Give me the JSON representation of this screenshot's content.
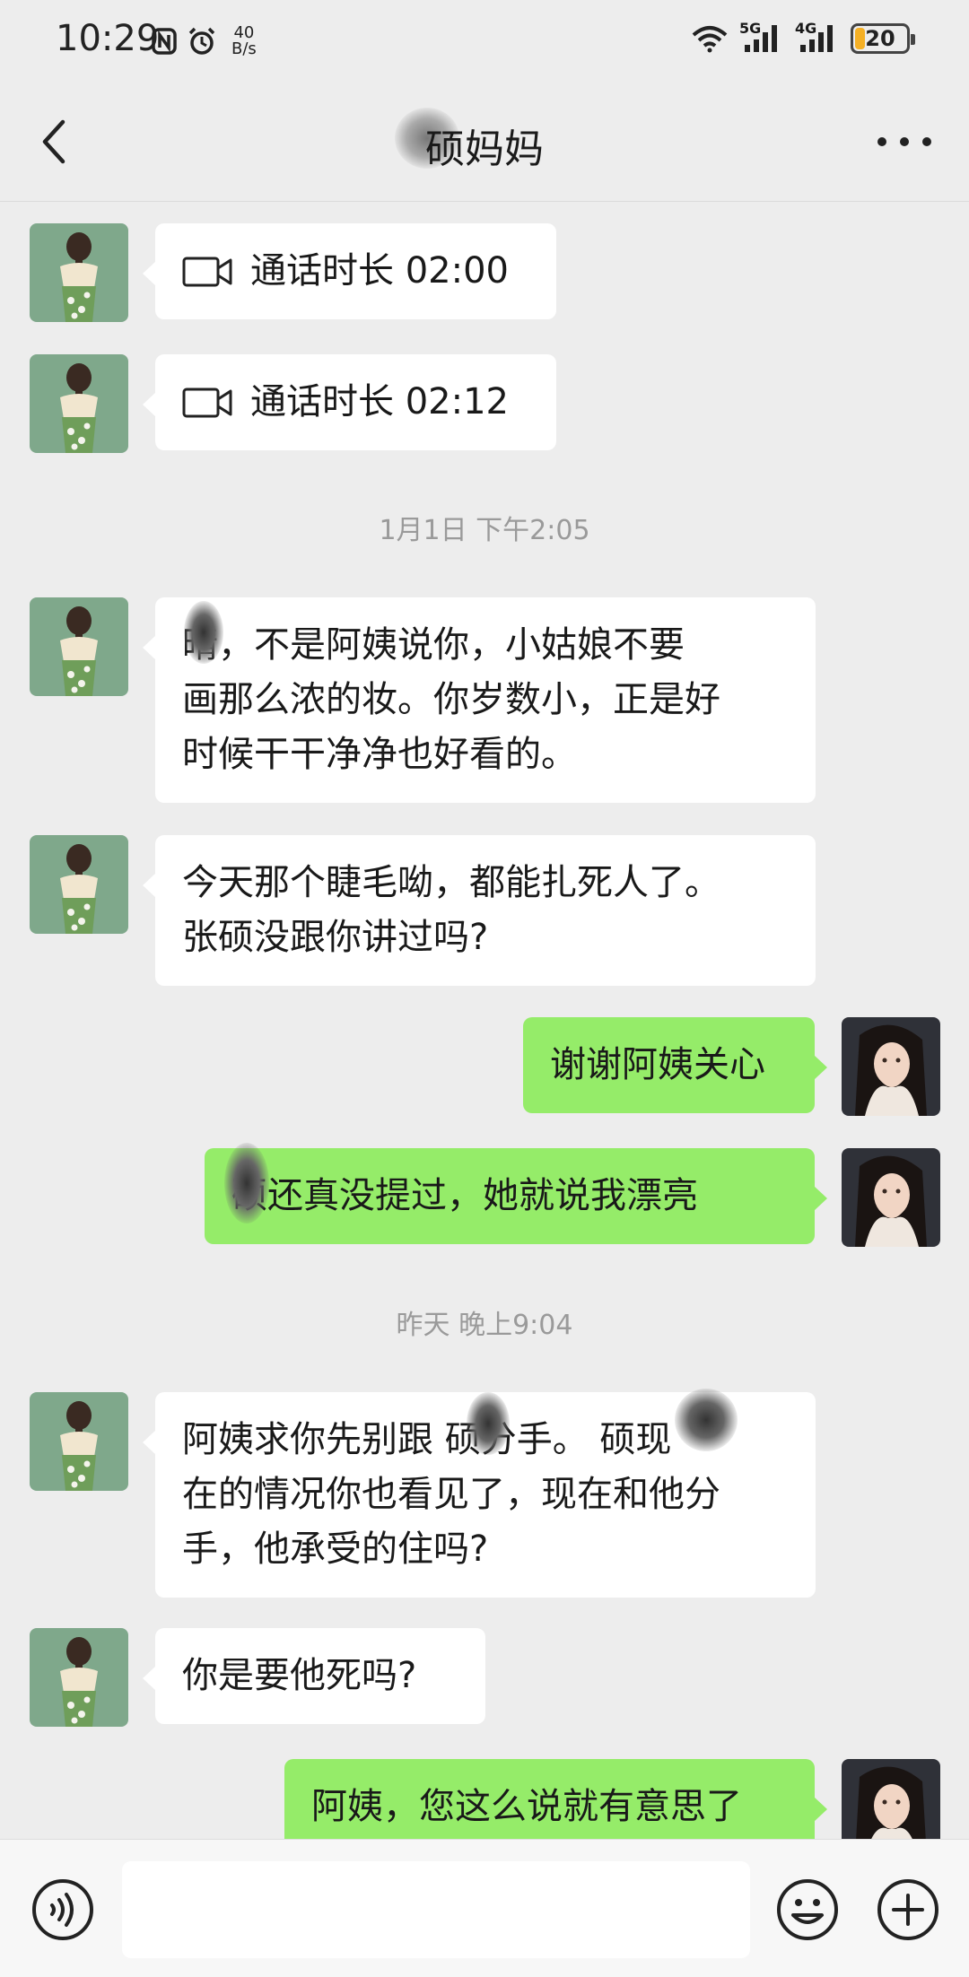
{
  "status_bar": {
    "time": "10:29",
    "net_speed_value": "40",
    "net_speed_unit": "B/s",
    "signal_1_label": "5G",
    "signal_2_label": "4G",
    "battery_level": "20"
  },
  "header": {
    "title": "硕妈妈"
  },
  "messages": [
    {
      "type": "call",
      "side": "in",
      "text": "通话时长 02:00"
    },
    {
      "type": "call",
      "side": "in",
      "text": "通话时长 02:12"
    },
    {
      "type": "time",
      "text": "1月1日 下午2:05"
    },
    {
      "type": "text",
      "side": "in",
      "lines": [
        "晴，不是阿姨说你，小姑娘不要",
        "画那么浓的妆。你岁数小，正是好",
        "时候干干净净也好看的。"
      ]
    },
    {
      "type": "text",
      "side": "in",
      "lines": [
        "今天那个睫毛呦，都能扎死人了。",
        "张硕没跟你讲过吗?"
      ]
    },
    {
      "type": "text",
      "side": "out",
      "lines": [
        "谢谢阿姨关心"
      ]
    },
    {
      "type": "text",
      "side": "out",
      "lines": [
        "硕还真没提过，她就说我漂亮"
      ]
    },
    {
      "type": "time",
      "text": "昨天 晚上9:04"
    },
    {
      "type": "text",
      "side": "in",
      "lines": [
        "阿姨求你先别跟 硕分手。 硕现",
        "在的情况你也看见了，现在和他分",
        "手，他承受的住吗?"
      ]
    },
    {
      "type": "text",
      "side": "in",
      "lines": [
        "你是要他死吗?"
      ]
    },
    {
      "type": "text",
      "side": "out",
      "lines": [
        "阿姨，您这么说就有意思了"
      ]
    }
  ],
  "colors": {
    "background": "#ededed",
    "bubble_in": "#ffffff",
    "bubble_out": "#95ec69",
    "timestamp": "#9a9a9a",
    "battery": "#f5b025"
  },
  "icons": {
    "back": "chevron-left-icon",
    "more": "more-dots-icon",
    "video_call": "video-call-icon",
    "voice": "voice-input-icon",
    "emoji": "emoji-icon",
    "plus": "plus-icon"
  }
}
